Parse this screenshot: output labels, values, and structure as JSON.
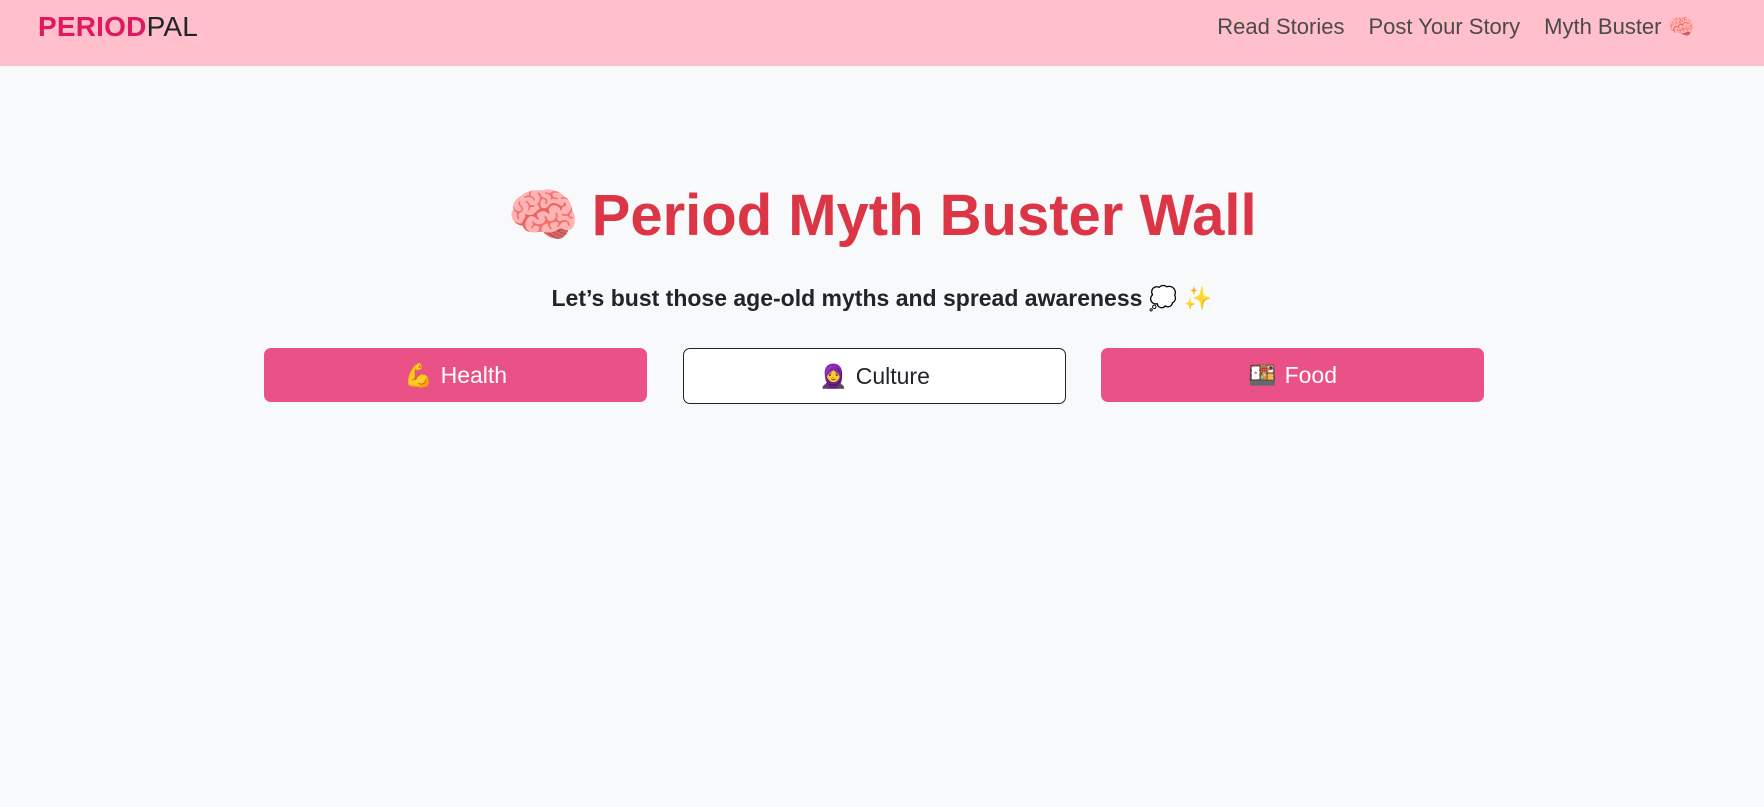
{
  "navbar": {
    "brand_accent": "PERIOD",
    "brand_rest": "PAL",
    "links": [
      {
        "label": "Read Stories"
      },
      {
        "label": "Post Your Story"
      },
      {
        "label": "Myth Buster 🧠"
      }
    ]
  },
  "hero": {
    "title_emoji": "🧠",
    "title": "Period Myth Buster Wall",
    "subtitle": "Let’s bust those age-old myths and spread awareness 💭 ✨"
  },
  "categories": [
    {
      "icon": "💪",
      "label": "Health",
      "style": "filled"
    },
    {
      "icon": "🧕",
      "label": "Culture",
      "style": "outline"
    },
    {
      "icon": "🍱",
      "label": "Food",
      "style": "filled"
    }
  ],
  "colors": {
    "navbar_bg": "#ffbfcb",
    "brand_accent": "#e0185f",
    "title": "#dc3545",
    "button_fill": "#ea5287",
    "page_bg": "#f8f9fa"
  }
}
